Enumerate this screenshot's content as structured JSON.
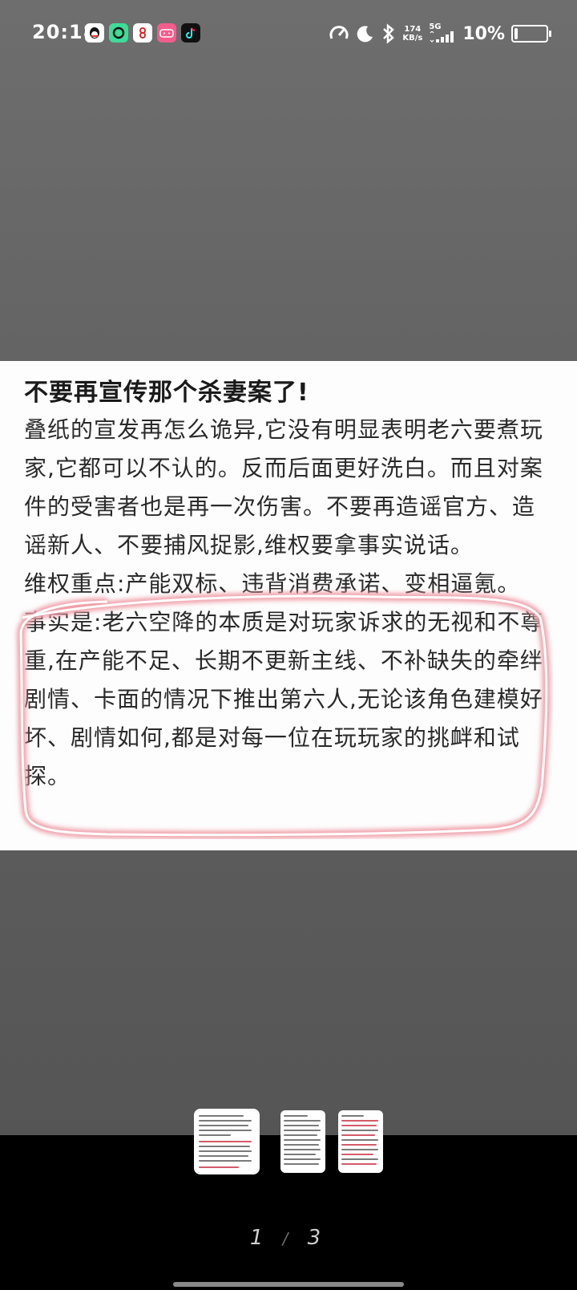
{
  "status_bar": {
    "time": "20:18",
    "net_speed_value": "174",
    "net_speed_unit": "KB/s",
    "network": "5G",
    "battery_percent": "10%",
    "battery_level": 0.1
  },
  "document": {
    "title": "不要再宣传那个杀妻案了!",
    "paragraph_1": "叠纸的宣发再怎么诡异,它没有明显表明老六要煮玩家,它都可以不认的。反而后面更好洗白。而且对案件的受害者也是再一次伤害。不要再造谣官方、造谣新人、不要捕风捉影,维权要拿事实说话。",
    "paragraph_2": "维权重点:产能双标、违背消费承诺、变相逼氪。",
    "paragraph_3": "事实是:老六空降的本质是对玩家诉求的无视和不尊重,在产能不足、长期不更新主线、不补缺失的牵绊剧情、卡面的情况下推出第六人,无论该角色建模好坏、剧情如何,都是对每一位在玩玩家的挑衅和试探。"
  },
  "pager": {
    "current": "1",
    "separator": "/",
    "total": "3"
  },
  "colors": {
    "highlight": "#e85a6e",
    "background": "#636363"
  }
}
